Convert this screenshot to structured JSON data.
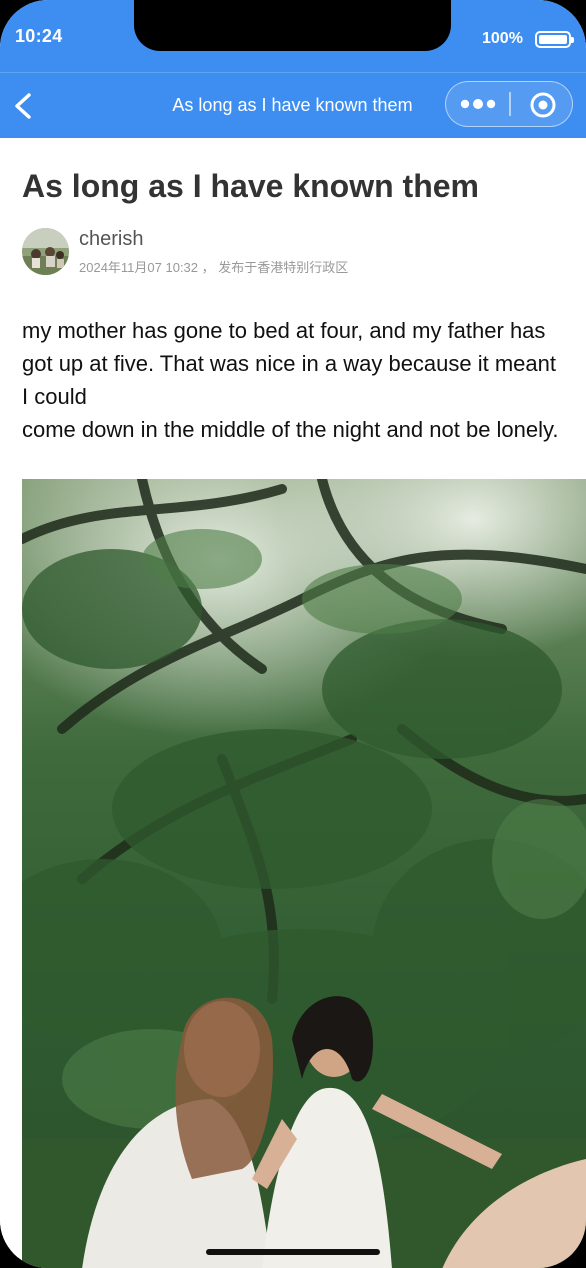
{
  "status": {
    "time": "10:24",
    "battery": "100%"
  },
  "nav": {
    "title": "As long as I have known them",
    "back_icon": "chevron-left-icon",
    "more_icon": "more-dots-icon",
    "close_icon": "target-close-icon"
  },
  "article": {
    "title": "As long as I have known them",
    "author": "cherish",
    "meta": "2024年11月07 10:32 ，  发布于香港特别行政区",
    "paragraphs": [
      "my mother has gone to bed at four, and my father has got up at five. That was nice in a way because it meant I could",
      "come down in the middle of the night and not be lonely."
    ]
  },
  "colors": {
    "accent": "#3d8ef0",
    "title_text": "#333333",
    "meta_text": "#999999"
  }
}
